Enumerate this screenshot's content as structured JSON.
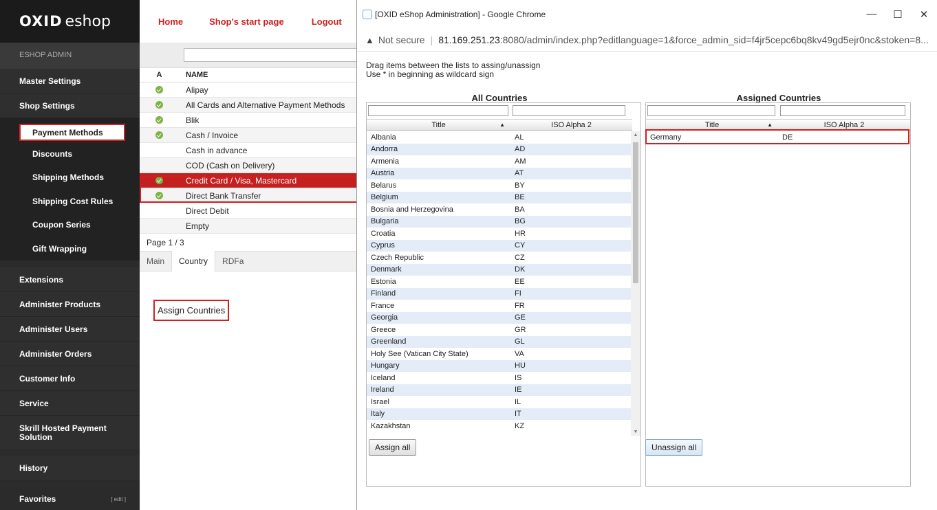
{
  "nav": {
    "logo_bold": "OXID",
    "logo_light": "eshop",
    "admin_label": "ESHOP ADMIN",
    "groups": [
      "Master Settings",
      "Shop Settings"
    ],
    "shop_settings_items": [
      "Payment Methods",
      "Discounts",
      "Shipping Methods",
      "Shipping Cost Rules",
      "Coupon Series",
      "Gift Wrapping"
    ],
    "more_groups": [
      "Extensions",
      "Administer Products",
      "Administer Users",
      "Administer Orders",
      "Customer Info",
      "Service",
      "Skrill Hosted Payment Solution",
      "History"
    ],
    "favorites": "Favorites",
    "favorites_edit": "[ edit ]"
  },
  "topnav": {
    "home": "Home",
    "start": "Shop's start page",
    "logout": "Logout"
  },
  "payment_list": {
    "col_active": "A",
    "col_name": "NAME",
    "rows": [
      {
        "name": "Alipay",
        "active": true
      },
      {
        "name": "All Cards and Alternative Payment Methods",
        "active": true
      },
      {
        "name": "Blik",
        "active": true
      },
      {
        "name": "Cash / Invoice",
        "active": true
      },
      {
        "name": "Cash in advance",
        "active": false
      },
      {
        "name": "COD (Cash on Delivery)",
        "active": false
      },
      {
        "name": "Credit Card / Visa, Mastercard",
        "active": true
      },
      {
        "name": "Direct Bank Transfer",
        "active": true
      },
      {
        "name": "Direct Debit",
        "active": false
      },
      {
        "name": "Empty",
        "active": false
      }
    ],
    "pager": "Page 1 / 3",
    "tabs": [
      "Main",
      "Country",
      "RDFa"
    ],
    "assign_link": "Assign Countries"
  },
  "popup": {
    "window_title": "[OXID eShop Administration] - Google Chrome",
    "not_secure": "Not secure",
    "url_host": "81.169.251.23",
    "url_rest": ":8080/admin/index.php?editlanguage=1&force_admin_sid=f4jr5cepc6bq8kv49gd5ejr0nc&stoken=8...",
    "instr1": "Drag items between the lists to assing/unassign",
    "instr2": "Use * in beginning as wildcard sign",
    "all_title": "All Countries",
    "assigned_title": "Assigned Countries",
    "col_title": "Title",
    "col_iso": "ISO Alpha 2",
    "all_countries": [
      [
        "Albania",
        "AL"
      ],
      [
        "Andorra",
        "AD"
      ],
      [
        "Armenia",
        "AM"
      ],
      [
        "Austria",
        "AT"
      ],
      [
        "Belarus",
        "BY"
      ],
      [
        "Belgium",
        "BE"
      ],
      [
        "Bosnia and Herzegovina",
        "BA"
      ],
      [
        "Bulgaria",
        "BG"
      ],
      [
        "Croatia",
        "HR"
      ],
      [
        "Cyprus",
        "CY"
      ],
      [
        "Czech Republic",
        "CZ"
      ],
      [
        "Denmark",
        "DK"
      ],
      [
        "Estonia",
        "EE"
      ],
      [
        "Finland",
        "FI"
      ],
      [
        "France",
        "FR"
      ],
      [
        "Georgia",
        "GE"
      ],
      [
        "Greece",
        "GR"
      ],
      [
        "Greenland",
        "GL"
      ],
      [
        "Holy See (Vatican City State)",
        "VA"
      ],
      [
        "Hungary",
        "HU"
      ],
      [
        "Iceland",
        "IS"
      ],
      [
        "Ireland",
        "IE"
      ],
      [
        "Israel",
        "IL"
      ],
      [
        "Italy",
        "IT"
      ],
      [
        "Kazakhstan",
        "KZ"
      ]
    ],
    "assigned_countries": [
      [
        "Germany",
        "DE"
      ]
    ],
    "assign_all": "Assign all",
    "unassign_all": "Unassign all"
  }
}
